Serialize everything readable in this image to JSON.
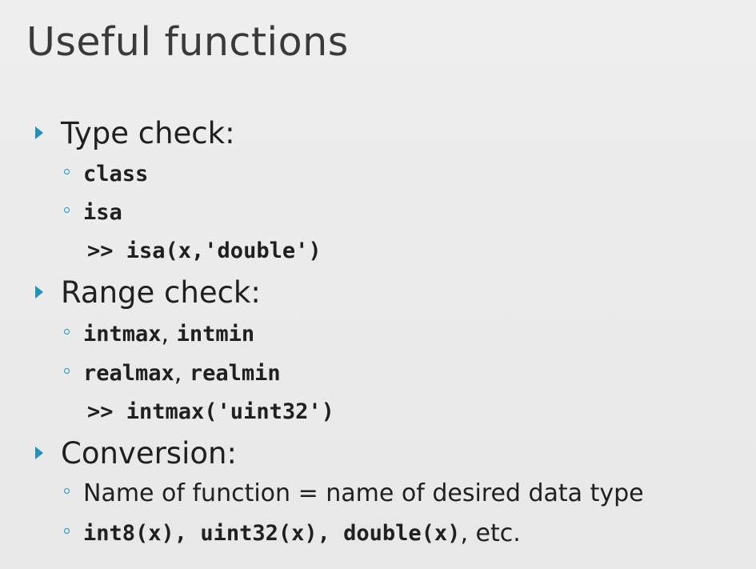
{
  "slide": {
    "title": "Useful functions",
    "sections": [
      {
        "heading": "Type check:",
        "items": [
          {
            "code": "class"
          },
          {
            "code": "isa"
          }
        ],
        "example": ">> isa(x,'double')"
      },
      {
        "heading": "Range check:",
        "items": [
          {
            "code_a": "intmax",
            "sep": ", ",
            "code_b": "intmin"
          },
          {
            "code_a": "realmax",
            "sep": ", ",
            "code_b": "realmin"
          }
        ],
        "example": ">> intmax('uint32')"
      },
      {
        "heading": "Conversion:",
        "items": [
          {
            "text": "Name of function = name of desired data type"
          },
          {
            "code_a": "int8(x)",
            "sep1": ", ",
            "code_b": "uint32(x)",
            "sep2": ", ",
            "code_c": "double(x)",
            "tail": ", etc."
          }
        ]
      }
    ]
  },
  "colors": {
    "bullet_accent": "#2a8fb7",
    "background": "#ebebeb",
    "text": "#202020"
  },
  "icons": {
    "level1_bullet": "triangle-right-icon",
    "level2_bullet": "hollow-circle-icon"
  }
}
